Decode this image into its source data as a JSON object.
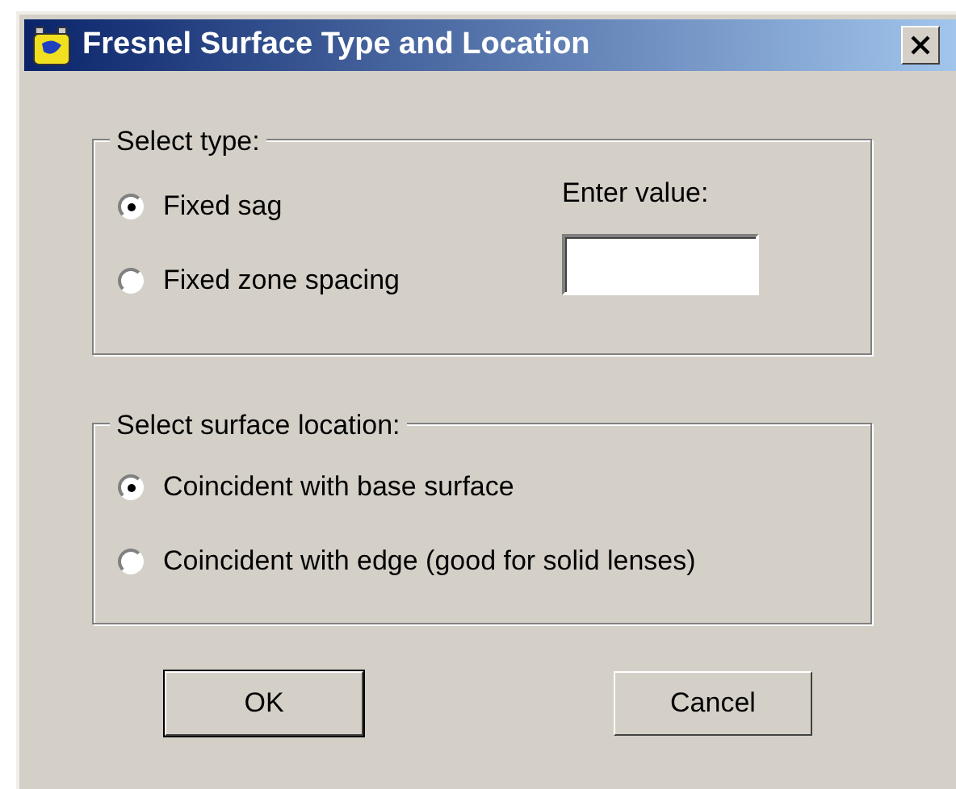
{
  "window": {
    "title": "Fresnel Surface Type and Location"
  },
  "type_group": {
    "legend": "Select type:",
    "options": [
      {
        "label": "Fixed sag",
        "selected": true
      },
      {
        "label": "Fixed zone spacing",
        "selected": false
      }
    ],
    "value_label": "Enter value:"
  },
  "location_group": {
    "legend": "Select surface location:",
    "options": [
      {
        "label": "Coincident with base surface",
        "selected": true
      },
      {
        "label": "Coincident with edge (good for solid lenses)",
        "selected": false
      }
    ]
  },
  "buttons": [
    {
      "label": "OK",
      "default": true
    },
    {
      "label": "Cancel",
      "default": false
    }
  ]
}
